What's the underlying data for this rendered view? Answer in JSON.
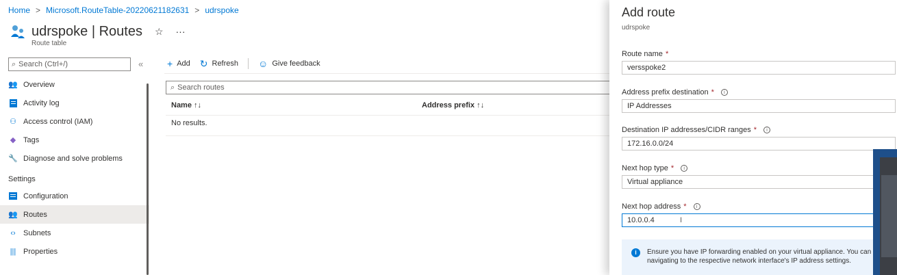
{
  "breadcrumb": [
    "Home",
    "Microsoft.RouteTable-20220621182631",
    "udrspoke"
  ],
  "page": {
    "title": "udrspoke | Routes",
    "subtitle": "Route table"
  },
  "sidebar": {
    "search_placeholder": "Search (Ctrl+/)",
    "items": [
      {
        "label": "Overview",
        "icon": "overview-icon"
      },
      {
        "label": "Activity log",
        "icon": "activity-log-icon"
      },
      {
        "label": "Access control (IAM)",
        "icon": "iam-icon"
      },
      {
        "label": "Tags",
        "icon": "tag-icon"
      },
      {
        "label": "Diagnose and solve problems",
        "icon": "wrench-icon"
      }
    ],
    "section": "Settings",
    "settings_items": [
      {
        "label": "Configuration",
        "icon": "configuration-icon"
      },
      {
        "label": "Routes",
        "icon": "routes-icon",
        "active": true
      },
      {
        "label": "Subnets",
        "icon": "subnets-icon"
      },
      {
        "label": "Properties",
        "icon": "properties-icon"
      }
    ]
  },
  "toolbar": {
    "add": "Add",
    "refresh": "Refresh",
    "feedback": "Give feedback"
  },
  "routes": {
    "search_placeholder": "Search routes",
    "columns": [
      "Name",
      "Address prefix"
    ],
    "empty": "No results."
  },
  "panel": {
    "title": "Add route",
    "subtitle": "udrspoke",
    "fields": [
      {
        "label": "Route name",
        "value": "versspoke2"
      },
      {
        "label": "Address prefix destination",
        "value": "IP Addresses"
      },
      {
        "label": "Destination IP addresses/CIDR ranges",
        "value": "172.16.0.0/24"
      },
      {
        "label": "Next hop type",
        "value": "Virtual appliance"
      },
      {
        "label": "Next hop address",
        "value": "10.0.0.4"
      }
    ],
    "notice": "Ensure you have IP forwarding enabled on your virtual appliance. You can navigating to the respective network interface's IP address settings."
  },
  "colors": {
    "accent": "#0078d4",
    "required": "#a4262c"
  }
}
